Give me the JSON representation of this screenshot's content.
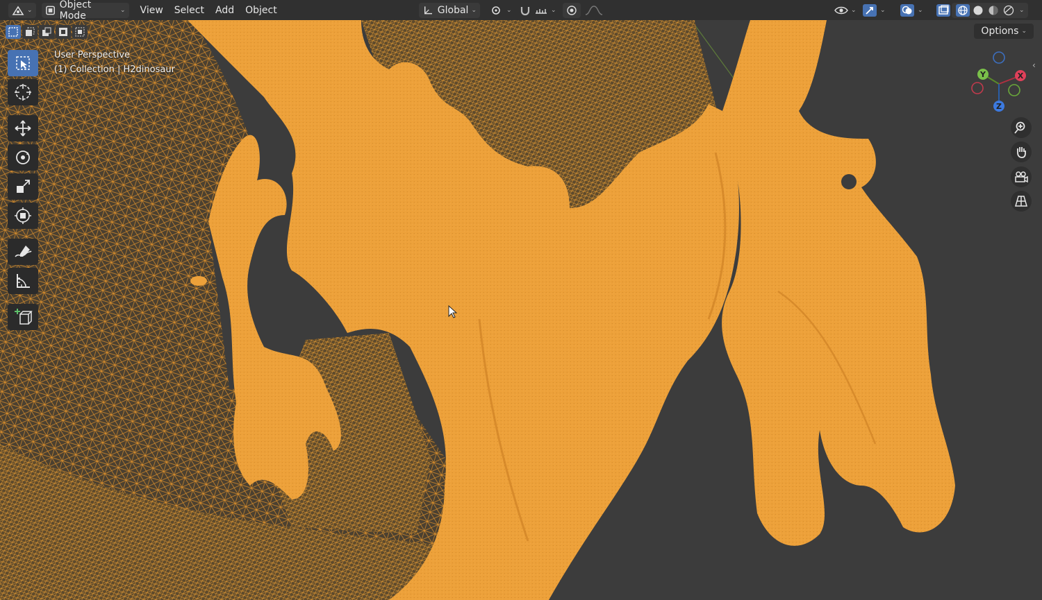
{
  "header": {
    "editor_icon": "editor-type-icon",
    "mode_label": "Object Mode",
    "menus": [
      "View",
      "Select",
      "Add",
      "Object"
    ],
    "transform_orientation": "Global"
  },
  "viewport": {
    "perspective_label": "User Perspective",
    "collection_label": "(1) Collection | H2dinosaur",
    "options_label": "Options"
  },
  "gizmo": {
    "x": "X",
    "y": "Y",
    "z": "Z"
  },
  "colors": {
    "accent": "#4772b3",
    "mesh": "#f0a030",
    "wire": "#e89a2e",
    "background": "#3c3c3c",
    "header": "#303030"
  },
  "tools": [
    "select-box-icon",
    "cursor-icon",
    "move-icon",
    "rotate-icon",
    "scale-icon",
    "transform-icon",
    "annotate-icon",
    "measure-icon",
    "add-cube-icon"
  ]
}
